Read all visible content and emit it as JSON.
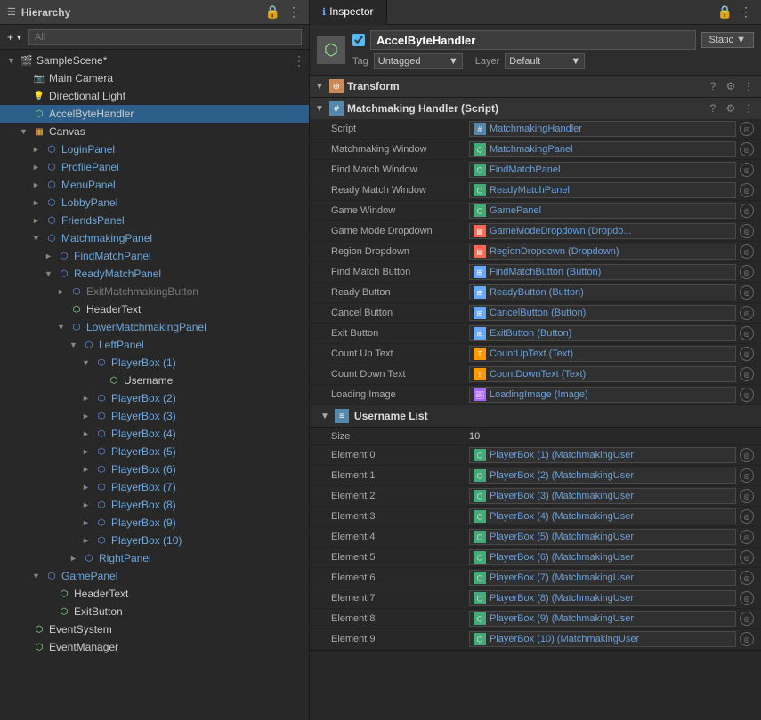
{
  "hierarchy": {
    "title": "Hierarchy",
    "search_placeholder": "All",
    "scene": {
      "name": "SampleScene*",
      "children": [
        {
          "id": "main-camera",
          "label": "Main Camera",
          "icon": "camera",
          "indent": 1,
          "arrow": "leaf"
        },
        {
          "id": "directional-light",
          "label": "Directional Light",
          "icon": "light",
          "indent": 1,
          "arrow": "leaf"
        },
        {
          "id": "accelbyte-handler",
          "label": "AccelByteHandler",
          "icon": "gameobj",
          "indent": 1,
          "arrow": "leaf",
          "selected": true
        },
        {
          "id": "canvas",
          "label": "Canvas",
          "icon": "canvas",
          "indent": 1,
          "arrow": "open"
        },
        {
          "id": "login-panel",
          "label": "LoginPanel",
          "icon": "prefab",
          "indent": 2,
          "arrow": "closed",
          "prefab": true
        },
        {
          "id": "profile-panel",
          "label": "ProfilePanel",
          "icon": "prefab",
          "indent": 2,
          "arrow": "closed",
          "prefab": true
        },
        {
          "id": "menu-panel",
          "label": "MenuPanel",
          "icon": "prefab",
          "indent": 2,
          "arrow": "closed",
          "prefab": true
        },
        {
          "id": "lobby-panel",
          "label": "LobbyPanel",
          "icon": "prefab",
          "indent": 2,
          "arrow": "closed",
          "prefab": true
        },
        {
          "id": "friends-panel",
          "label": "FriendsPanel",
          "icon": "prefab",
          "indent": 2,
          "arrow": "closed",
          "prefab": true
        },
        {
          "id": "matchmaking-panel",
          "label": "MatchmakingPanel",
          "icon": "prefab",
          "indent": 2,
          "arrow": "open",
          "prefab": true
        },
        {
          "id": "find-match-panel",
          "label": "FindMatchPanel",
          "icon": "prefab",
          "indent": 3,
          "arrow": "closed",
          "prefab": true
        },
        {
          "id": "ready-match-panel",
          "label": "ReadyMatchPanel",
          "icon": "prefab",
          "indent": 3,
          "arrow": "open",
          "prefab": true
        },
        {
          "id": "exit-matchmaking-btn",
          "label": "ExitMatchmakingButton",
          "icon": "prefab",
          "indent": 4,
          "arrow": "closed",
          "prefab": true,
          "inactive": true
        },
        {
          "id": "header-text",
          "label": "HeaderText",
          "icon": "gameobj",
          "indent": 4,
          "arrow": "leaf"
        },
        {
          "id": "lower-matchmaking-panel",
          "label": "LowerMatchmakingPanel",
          "icon": "prefab",
          "indent": 4,
          "arrow": "open",
          "prefab": true
        },
        {
          "id": "left-panel",
          "label": "LeftPanel",
          "icon": "prefab",
          "indent": 5,
          "arrow": "open",
          "prefab": true
        },
        {
          "id": "player-box-1",
          "label": "PlayerBox (1)",
          "icon": "prefab",
          "indent": 6,
          "arrow": "open",
          "prefab": true
        },
        {
          "id": "username",
          "label": "Username",
          "icon": "gameobj",
          "indent": 7,
          "arrow": "leaf"
        },
        {
          "id": "player-box-2",
          "label": "PlayerBox (2)",
          "icon": "prefab",
          "indent": 6,
          "arrow": "closed",
          "prefab": true
        },
        {
          "id": "player-box-3",
          "label": "PlayerBox (3)",
          "icon": "prefab",
          "indent": 6,
          "arrow": "closed",
          "prefab": true
        },
        {
          "id": "player-box-4",
          "label": "PlayerBox (4)",
          "icon": "prefab",
          "indent": 6,
          "arrow": "closed",
          "prefab": true
        },
        {
          "id": "player-box-5",
          "label": "PlayerBox (5)",
          "icon": "prefab",
          "indent": 6,
          "arrow": "closed",
          "prefab": true
        },
        {
          "id": "player-box-6",
          "label": "PlayerBox (6)",
          "icon": "prefab",
          "indent": 6,
          "arrow": "closed",
          "prefab": true
        },
        {
          "id": "player-box-7",
          "label": "PlayerBox (7)",
          "icon": "prefab",
          "indent": 6,
          "arrow": "closed",
          "prefab": true
        },
        {
          "id": "player-box-8",
          "label": "PlayerBox (8)",
          "icon": "prefab",
          "indent": 6,
          "arrow": "closed",
          "prefab": true
        },
        {
          "id": "player-box-9",
          "label": "PlayerBox (9)",
          "icon": "prefab",
          "indent": 6,
          "arrow": "closed",
          "prefab": true
        },
        {
          "id": "player-box-10",
          "label": "PlayerBox (10)",
          "icon": "prefab",
          "indent": 6,
          "arrow": "closed",
          "prefab": true
        },
        {
          "id": "right-panel",
          "label": "RightPanel",
          "icon": "prefab",
          "indent": 5,
          "arrow": "closed",
          "prefab": true
        },
        {
          "id": "game-panel",
          "label": "GamePanel",
          "icon": "prefab",
          "indent": 2,
          "arrow": "open",
          "prefab": true
        },
        {
          "id": "game-header-text",
          "label": "HeaderText",
          "icon": "gameobj",
          "indent": 3,
          "arrow": "leaf"
        },
        {
          "id": "exit-button",
          "label": "ExitButton",
          "icon": "gameobj",
          "indent": 3,
          "arrow": "leaf"
        },
        {
          "id": "event-system",
          "label": "EventSystem",
          "icon": "gameobj",
          "indent": 1,
          "arrow": "leaf"
        },
        {
          "id": "event-manager",
          "label": "EventManager",
          "icon": "gameobj",
          "indent": 1,
          "arrow": "leaf"
        }
      ]
    }
  },
  "inspector": {
    "tab_label": "Inspector",
    "tab_icon": "ℹ",
    "object": {
      "name": "AccelByteHandler",
      "enabled": true,
      "static_label": "Static ▼",
      "tag_label": "Tag",
      "tag_value": "Untagged",
      "layer_label": "Layer",
      "layer_value": "Default"
    },
    "components": {
      "transform": {
        "name": "Transform",
        "expanded": true
      },
      "matchmaking_handler": {
        "name": "Matchmaking Handler (Script)",
        "expanded": true,
        "properties": [
          {
            "label": "Script",
            "value": "MatchmakingHandler",
            "type": "script"
          },
          {
            "label": "Matchmaking Window",
            "value": "MatchmakingPanel",
            "type": "panel"
          },
          {
            "label": "Find Match Window",
            "value": "FindMatchPanel",
            "type": "panel"
          },
          {
            "label": "Ready Match Window",
            "value": "ReadyMatchPanel",
            "type": "panel"
          },
          {
            "label": "Game Window",
            "value": "GamePanel",
            "type": "panel"
          },
          {
            "label": "Game Mode Dropdown",
            "value": "GameModeDropdown (Dropdown)",
            "type": "dropdown"
          },
          {
            "label": "Region Dropdown",
            "value": "RegionDropdown (Dropdown)",
            "type": "dropdown"
          },
          {
            "label": "Find Match Button",
            "value": "FindMatchButton (Button)",
            "type": "btn"
          },
          {
            "label": "Ready Button",
            "value": "ReadyButton (Button)",
            "type": "btn"
          },
          {
            "label": "Cancel Button",
            "value": "CancelButton (Button)",
            "type": "btn"
          },
          {
            "label": "Exit Button",
            "value": "ExitButton (Button)",
            "type": "btn"
          },
          {
            "label": "Count Up Text",
            "value": "CountUpText (Text)",
            "type": "txt"
          },
          {
            "label": "Count Down Text",
            "value": "CountDownText (Text)",
            "type": "txt"
          },
          {
            "label": "Loading Image",
            "value": "LoadingImage (Image)",
            "type": "img"
          }
        ],
        "username_list": {
          "label": "Username List",
          "size_label": "Size",
          "size_value": "10",
          "elements": [
            {
              "label": "Element 0",
              "value": "PlayerBox (1) (MatchmakingUser"
            },
            {
              "label": "Element 1",
              "value": "PlayerBox (2) (MatchmakingUser"
            },
            {
              "label": "Element 2",
              "value": "PlayerBox (3) (MatchmakingUser"
            },
            {
              "label": "Element 3",
              "value": "PlayerBox (4) (MatchmakingUser"
            },
            {
              "label": "Element 4",
              "value": "PlayerBox (5) (MatchmakingUser"
            },
            {
              "label": "Element 5",
              "value": "PlayerBox (6) (MatchmakingUser"
            },
            {
              "label": "Element 6",
              "value": "PlayerBox (7) (MatchmakingUser"
            },
            {
              "label": "Element 7",
              "value": "PlayerBox (8) (MatchmakingUser"
            },
            {
              "label": "Element 8",
              "value": "PlayerBox (9) (MatchmakingUser"
            },
            {
              "label": "Element 9",
              "value": "PlayerBox (10) (MatchmakingUser"
            }
          ]
        }
      }
    }
  }
}
